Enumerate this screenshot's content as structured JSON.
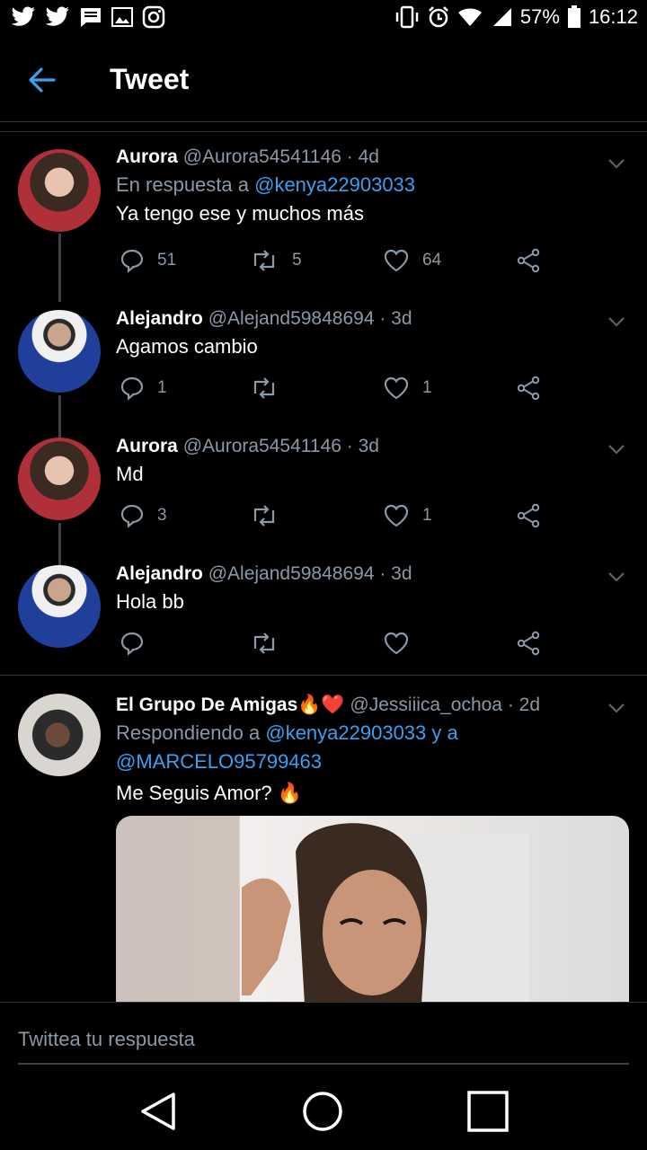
{
  "status_bar": {
    "battery": "57%",
    "time": "16:12"
  },
  "app_bar": {
    "title": "Tweet"
  },
  "tweets": [
    {
      "name": "Aurora",
      "handle": "@Aurora54541146",
      "age": "· 4d",
      "reply_prefix": "En respuesta a ",
      "reply_handle": "@kenya22903033",
      "text": "Ya tengo ese y muchos más",
      "replies": "51",
      "retweets": "5",
      "likes": "64"
    },
    {
      "name": "Alejandro",
      "handle": "@Alejand59848694",
      "age": "· 3d",
      "text": "Agamos cambio",
      "replies": "1",
      "retweets": "",
      "likes": "1"
    },
    {
      "name": "Aurora",
      "handle": "@Aurora54541146",
      "age": "· 3d",
      "text": "Md",
      "replies": "3",
      "retweets": "",
      "likes": "1"
    },
    {
      "name": "Alejandro",
      "handle": "@Alejand59848694",
      "age": "· 3d",
      "text": "Hola bb",
      "replies": "",
      "retweets": "",
      "likes": ""
    },
    {
      "name": "El Grupo De Amigas",
      "name_emoji": "🔥❤️",
      "handle": "@Jessiiica_ochoa",
      "age": "· 2d",
      "reply_prefix": "Respondiendo a ",
      "reply_handle": "@kenya22903033 y a",
      "reply_handle2": "@MARCELO95799463",
      "text": "Me Seguis Amor? 🔥"
    }
  ],
  "reply_bar": {
    "placeholder": "Twittea tu respuesta"
  },
  "colors": {
    "background": "#000000",
    "accent": "#3aa0f2",
    "muted": "#8b98a5",
    "divider": "#2f3336"
  }
}
